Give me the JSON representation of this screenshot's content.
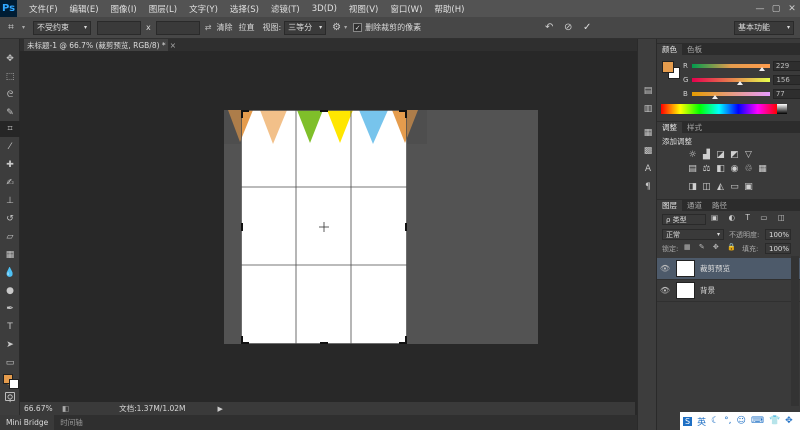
{
  "app": {
    "logo": "Ps"
  },
  "menu": [
    "文件(F)",
    "编辑(E)",
    "图像(I)",
    "图层(L)",
    "文字(Y)",
    "选择(S)",
    "滤镜(T)",
    "3D(D)",
    "视图(V)",
    "窗口(W)",
    "帮助(H)"
  ],
  "window_controls": {
    "minimize": "—",
    "restore": "▢",
    "close": "✕"
  },
  "options": {
    "ratio_select": "不受约束",
    "times": "x",
    "clear_label": "清除",
    "straighten_label": "拉直",
    "view_label": "视图:",
    "view_select": "三等分",
    "delete_cropped_label": "删除裁剪的像素",
    "delete_cropped_checked": true,
    "workspace_select": "基本功能"
  },
  "document": {
    "tab_title": "未标题-1 @ 66.7% (裁剪预览, RGB/8) *",
    "close": "×"
  },
  "status": {
    "zoom": "66.67%",
    "doc_info": "文档:1.37M/1.02M"
  },
  "bottom_tabs": [
    "Mini Bridge",
    "时间轴"
  ],
  "panels": {
    "color_tabs": [
      "颜色",
      "色板"
    ],
    "color": {
      "r_label": "R",
      "g_label": "G",
      "b_label": "B",
      "r_value": 229,
      "g_value": 156,
      "b_value": 77,
      "foreground": "#e59c4d",
      "background": "#ffffff"
    },
    "adjust_tabs": [
      "调整",
      "样式"
    ],
    "adjust_title": "添加调整",
    "layers_tabs": [
      "图层",
      "通道",
      "路径"
    ],
    "layers": {
      "kind_filter": "ρ 类型",
      "blend_mode": "正常",
      "opacity_label": "不透明度:",
      "opacity_value": "100%",
      "lock_label": "锁定:",
      "fill_label": "填充:",
      "fill_value": "100%",
      "items": [
        {
          "name": "裁剪预览",
          "selected": true
        },
        {
          "name": "背景",
          "selected": false
        }
      ]
    }
  },
  "tray": {
    "ime": "英"
  },
  "icons": {
    "crop_tool": "crop-icon",
    "move_tool": "move-icon",
    "reset": "reset-icon",
    "cancel": "cancel-icon",
    "commit": "check-icon",
    "eye": "eye-icon"
  },
  "canvas_colors": [
    "#e59c4d",
    "#f2c089",
    "#7fbf2a",
    "#ffe600",
    "#77c4ec",
    "#e59c4d"
  ]
}
